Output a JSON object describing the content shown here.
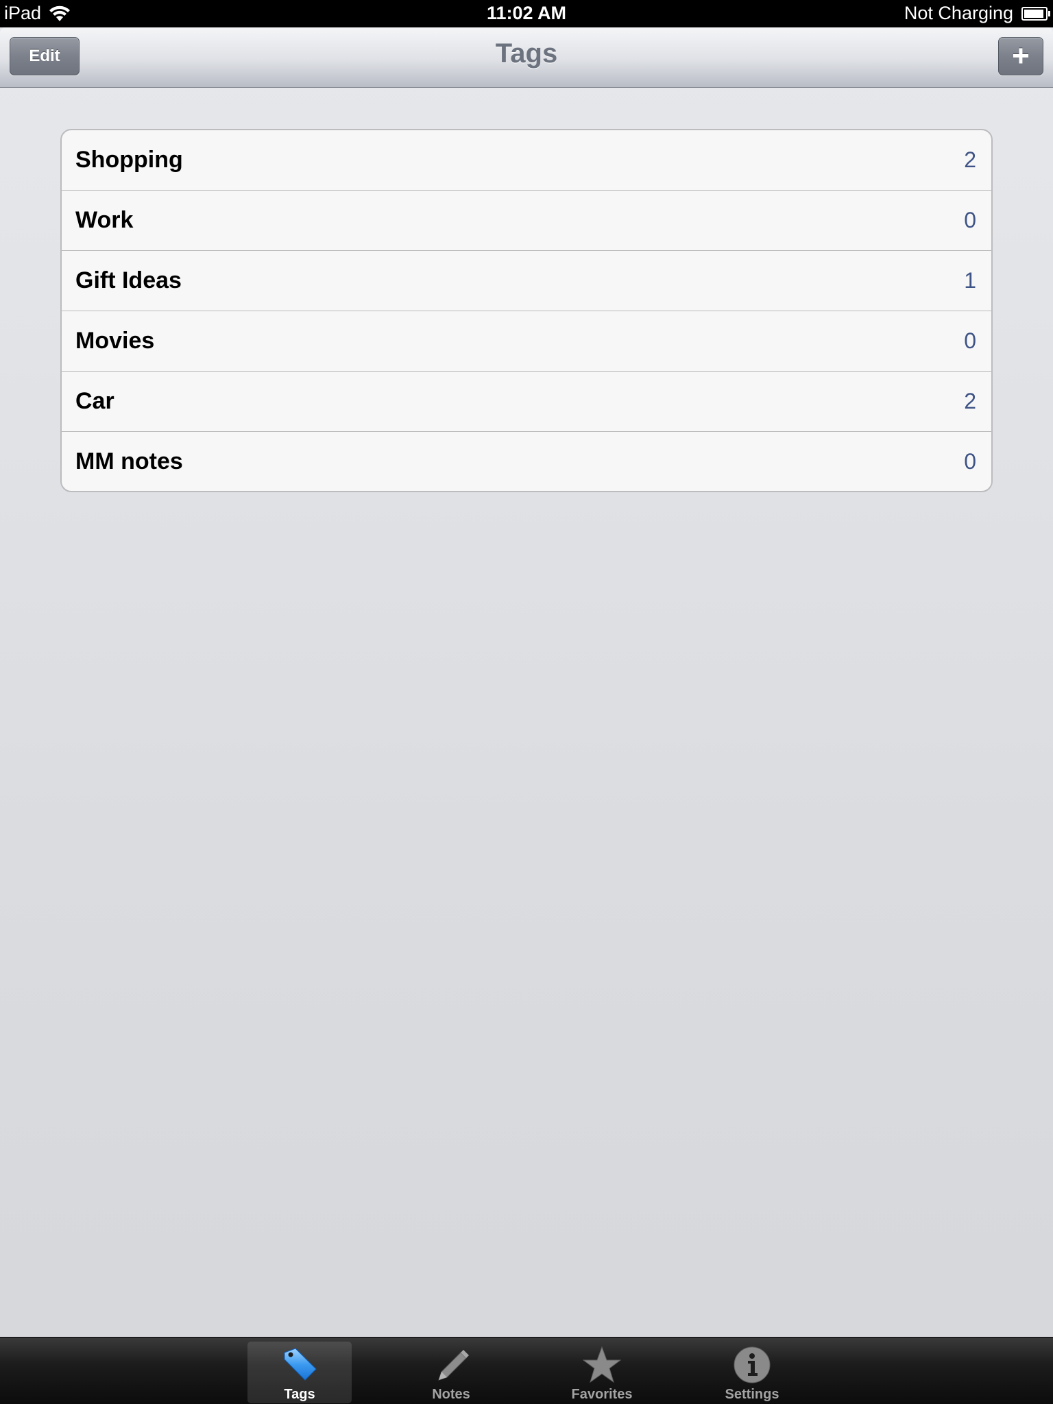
{
  "status_bar": {
    "device": "iPad",
    "time": "11:02 AM",
    "charge_status": "Not Charging"
  },
  "nav_bar": {
    "title": "Tags",
    "edit_label": "Edit",
    "add_label": "+"
  },
  "tags": [
    {
      "name": "Shopping",
      "count": "2"
    },
    {
      "name": "Work",
      "count": "0"
    },
    {
      "name": "Gift Ideas",
      "count": "1"
    },
    {
      "name": "Movies",
      "count": "0"
    },
    {
      "name": "Car",
      "count": "2"
    },
    {
      "name": "MM notes",
      "count": "0"
    }
  ],
  "tab_bar": {
    "tabs": [
      {
        "label": "Tags",
        "icon": "tag-icon",
        "selected": true
      },
      {
        "label": "Notes",
        "icon": "pencil-icon",
        "selected": false
      },
      {
        "label": "Favorites",
        "icon": "star-icon",
        "selected": false
      },
      {
        "label": "Settings",
        "icon": "info-icon",
        "selected": false
      }
    ]
  },
  "colors": {
    "count_text": "#3f5486",
    "selected_tab_icon": "#3d9bf0"
  }
}
